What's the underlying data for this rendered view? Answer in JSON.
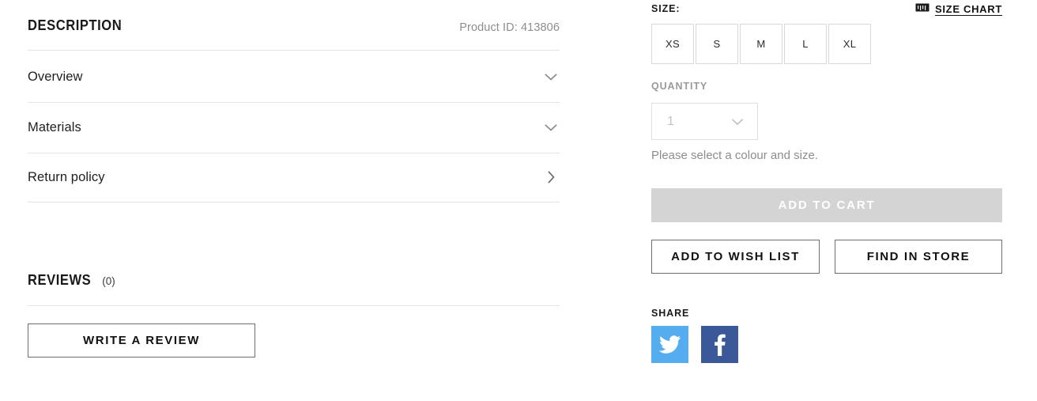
{
  "description": {
    "heading": "DESCRIPTION",
    "product_id_label": "Product ID: 413806",
    "accordion": [
      {
        "label": "Overview",
        "icon": "chevron-down-icon"
      },
      {
        "label": "Materials",
        "icon": "chevron-down-icon"
      },
      {
        "label": "Return policy",
        "icon": "chevron-right-icon"
      }
    ]
  },
  "reviews": {
    "heading": "REVIEWS",
    "count": "(0)",
    "write_review_label": "Write a Review"
  },
  "purchase": {
    "size_label": "SIZE:",
    "size_chart_label": "Size Chart",
    "size_chart_icon": "ruler-icon",
    "sizes": [
      {
        "label": "XS"
      },
      {
        "label": "S"
      },
      {
        "label": "M"
      },
      {
        "label": "L"
      },
      {
        "label": "XL"
      }
    ],
    "quantity_label": "QUANTITY",
    "quantity_value": "1",
    "quantity_icon": "chevron-down-icon",
    "helper_text": "Please select a colour and size.",
    "add_to_cart_label": "Add to Cart",
    "add_to_wish_list_label": "Add to Wish List",
    "find_in_store_label": "Find in Store"
  },
  "share": {
    "label": "SHARE",
    "items": [
      {
        "name": "twitter-icon",
        "color": "#55ACEE"
      },
      {
        "name": "facebook-icon",
        "color": "#3B5998"
      }
    ]
  }
}
